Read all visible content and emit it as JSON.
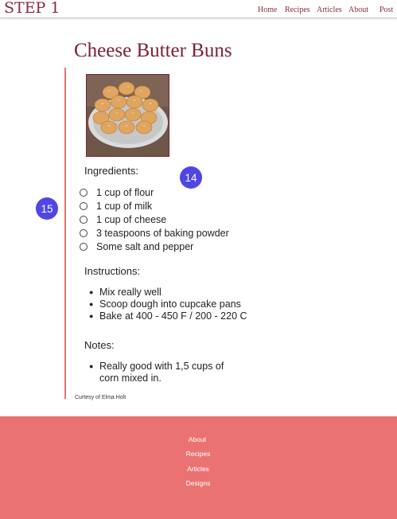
{
  "header": {
    "logo": "STEP 1",
    "nav": [
      "Home",
      "Recipes",
      "Articles",
      "About",
      "Post"
    ]
  },
  "recipe": {
    "title": "Cheese Butter Buns",
    "ingredients_label": "Ingredients:",
    "ingredients": [
      "1 cup of flour",
      "1 cup of milk",
      "1 cup of cheese",
      "3 teaspoons of baking powder",
      "Some salt and pepper"
    ],
    "instructions_label": "Instructions:",
    "instructions": [
      "Mix really well",
      "Scoop dough into cupcake pans",
      "Bake at 400 - 450 F / 200 - 220 C"
    ],
    "notes_label": "Notes:",
    "notes": [
      "Really good with 1,5 cups of corn mixed in."
    ],
    "credit": "Curtesy of Elma Holt"
  },
  "badges": [
    "14",
    "15"
  ],
  "footer": {
    "links": [
      "About",
      "Recipes",
      "Articles",
      "Designs"
    ]
  },
  "colors": {
    "brand": "#8a2a3c",
    "accent_line": "#e87272",
    "footer_bg": "#ea7272",
    "badge": "#4f46e5"
  }
}
